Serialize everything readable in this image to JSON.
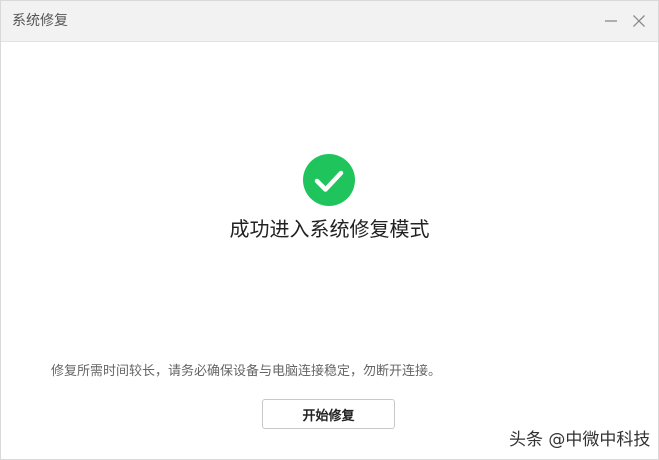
{
  "window": {
    "title": "系统修复"
  },
  "content": {
    "success_title": "成功进入系统修复模式",
    "notice": "修复所需时间较长，请务必确保设备与电脑连接稳定，勿断开连接。",
    "start_button_label": "开始修复"
  },
  "watermark": {
    "text": "头条 @中微中科技"
  },
  "icons": {
    "success": "check-circle-icon",
    "minimize": "minimize-icon",
    "close": "close-icon"
  },
  "colors": {
    "success_green": "#1fc55c",
    "titlebar_bg": "#f2f2f2"
  }
}
